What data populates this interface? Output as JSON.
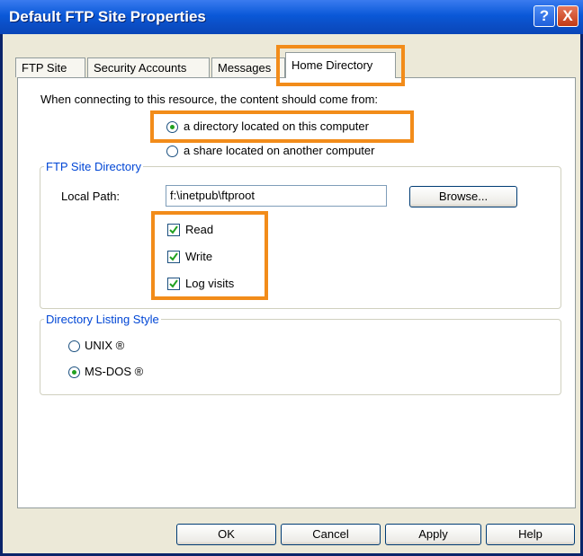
{
  "window": {
    "title": "Default FTP Site Properties"
  },
  "titlebar": {
    "help_label": "?",
    "close_label": "X"
  },
  "tabs": [
    {
      "label": "FTP Site"
    },
    {
      "label": "Security Accounts"
    },
    {
      "label": "Messages"
    },
    {
      "label": "Home Directory"
    }
  ],
  "panel": {
    "intro": "When connecting to this resource, the content should come from:",
    "source_options": [
      {
        "label": "a directory located on this computer",
        "selected": true
      },
      {
        "label": "a share located on another computer",
        "selected": false
      }
    ],
    "ftp_dir": {
      "legend": "FTP Site Directory",
      "local_path_label": "Local Path:",
      "local_path_value": "f:\\inetpub\\ftproot",
      "browse_label": "Browse...",
      "permissions": [
        {
          "label": "Read",
          "checked": true
        },
        {
          "label": "Write",
          "checked": true
        },
        {
          "label": "Log visits",
          "checked": true
        }
      ]
    },
    "listing_style": {
      "legend": "Directory Listing Style",
      "options": [
        {
          "label": "UNIX ®",
          "selected": false
        },
        {
          "label": "MS-DOS ®",
          "selected": true
        }
      ]
    }
  },
  "footer": {
    "ok_label": "OK",
    "cancel_label": "Cancel",
    "apply_label": "Apply",
    "help_label": "Help"
  },
  "colors": {
    "titlebar": "#0A58D8",
    "highlight": "#F28C1A",
    "radio_dot": "#21A121",
    "legend_text": "#0046D5"
  }
}
